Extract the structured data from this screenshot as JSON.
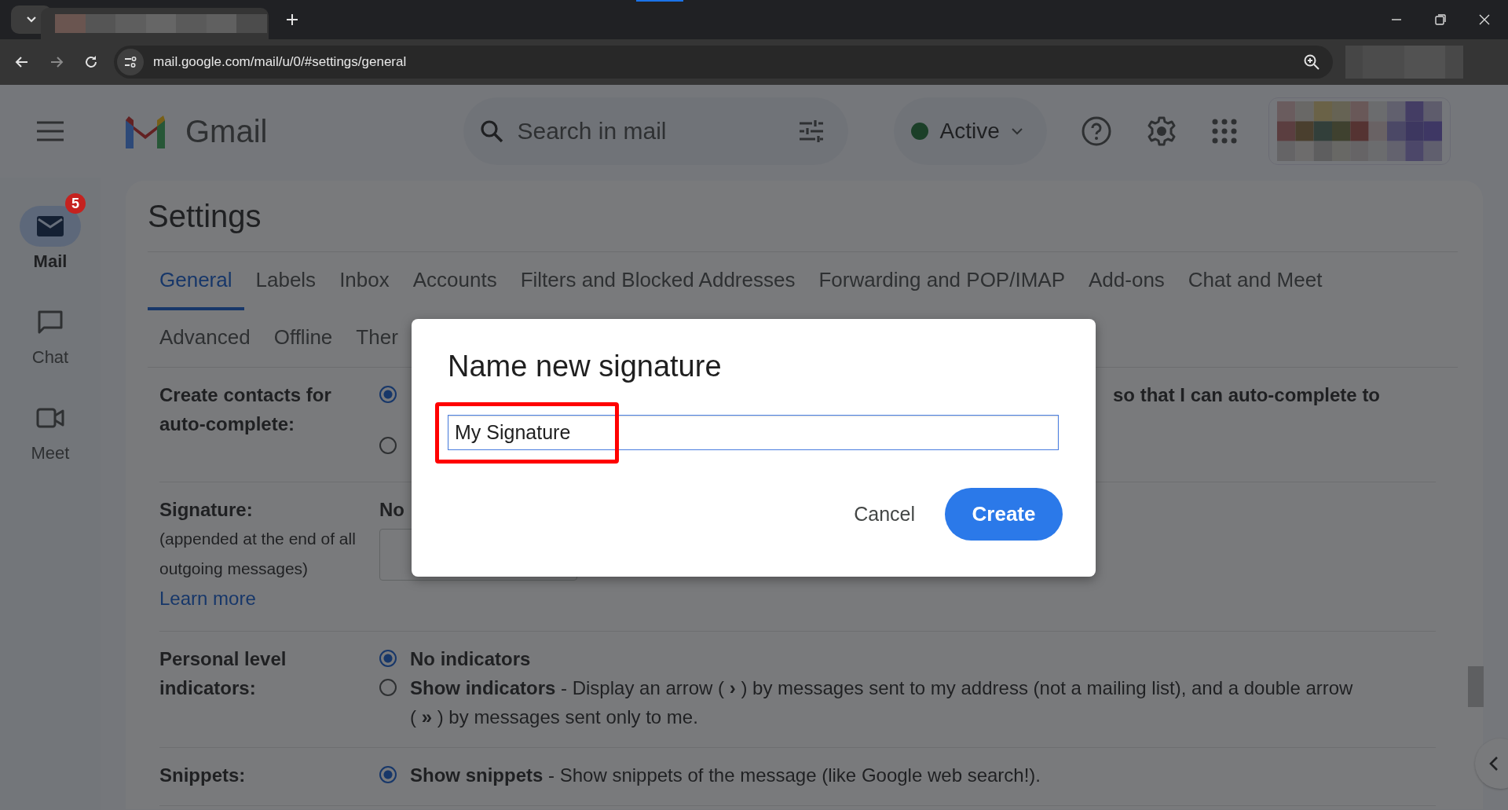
{
  "browser": {
    "address": "mail.google.com/mail/u/0/#settings/general"
  },
  "header": {
    "app_name": "Gmail",
    "search_placeholder": "Search in mail",
    "status": "Active"
  },
  "rail": [
    {
      "kind": "mail",
      "label": "Mail",
      "badge": "5",
      "selected": true
    },
    {
      "kind": "chat",
      "label": "Chat",
      "selected": false
    },
    {
      "kind": "meet",
      "label": "Meet",
      "selected": false
    }
  ],
  "settings": {
    "title": "Settings",
    "tab_rows": [
      [
        {
          "label": "General",
          "selected": true
        },
        {
          "label": "Labels",
          "selected": false
        },
        {
          "label": "Inbox",
          "selected": false
        },
        {
          "label": "Accounts",
          "selected": false
        },
        {
          "label": "Filters and Blocked Addresses",
          "selected": false
        },
        {
          "label": "Forwarding and POP/IMAP",
          "selected": false
        },
        {
          "label": "Add-ons",
          "selected": false
        },
        {
          "label": "Chat and Meet",
          "selected": false
        }
      ],
      [
        {
          "label": "Advanced",
          "selected": false
        },
        {
          "label": "Offline",
          "selected": false
        },
        {
          "label": "Ther",
          "selected": false
        }
      ]
    ],
    "sections": [
      {
        "kind": "contacts",
        "label": "Create contacts for auto-complete:",
        "options": [
          {
            "selected": true,
            "fragment": "so that I can auto-complete to"
          },
          {
            "selected": false
          }
        ]
      },
      {
        "kind": "signature",
        "label": "Signature:",
        "note": "(appended at the end of all outgoing messages)",
        "link": "Learn more",
        "value": "No"
      },
      {
        "kind": "options",
        "label": "Personal level indicators:",
        "options": [
          {
            "selected": true,
            "title": "No indicators"
          },
          {
            "selected": false,
            "title": "Show indicators",
            "description": " - Display an arrow ( **›** ) by messages sent to my address (not a mailing list), and a double arrow ( **»** ) by messages sent only to me."
          }
        ]
      },
      {
        "kind": "options",
        "label": "Snippets:",
        "options": [
          {
            "selected": true,
            "title": "Show snippets",
            "description": " - Show snippets of the message (like Google web search!)."
          }
        ]
      }
    ]
  },
  "dialog": {
    "title": "Name new signature",
    "value": "My Signature",
    "highlighted": true,
    "cancel": "Cancel",
    "create": "Create"
  }
}
